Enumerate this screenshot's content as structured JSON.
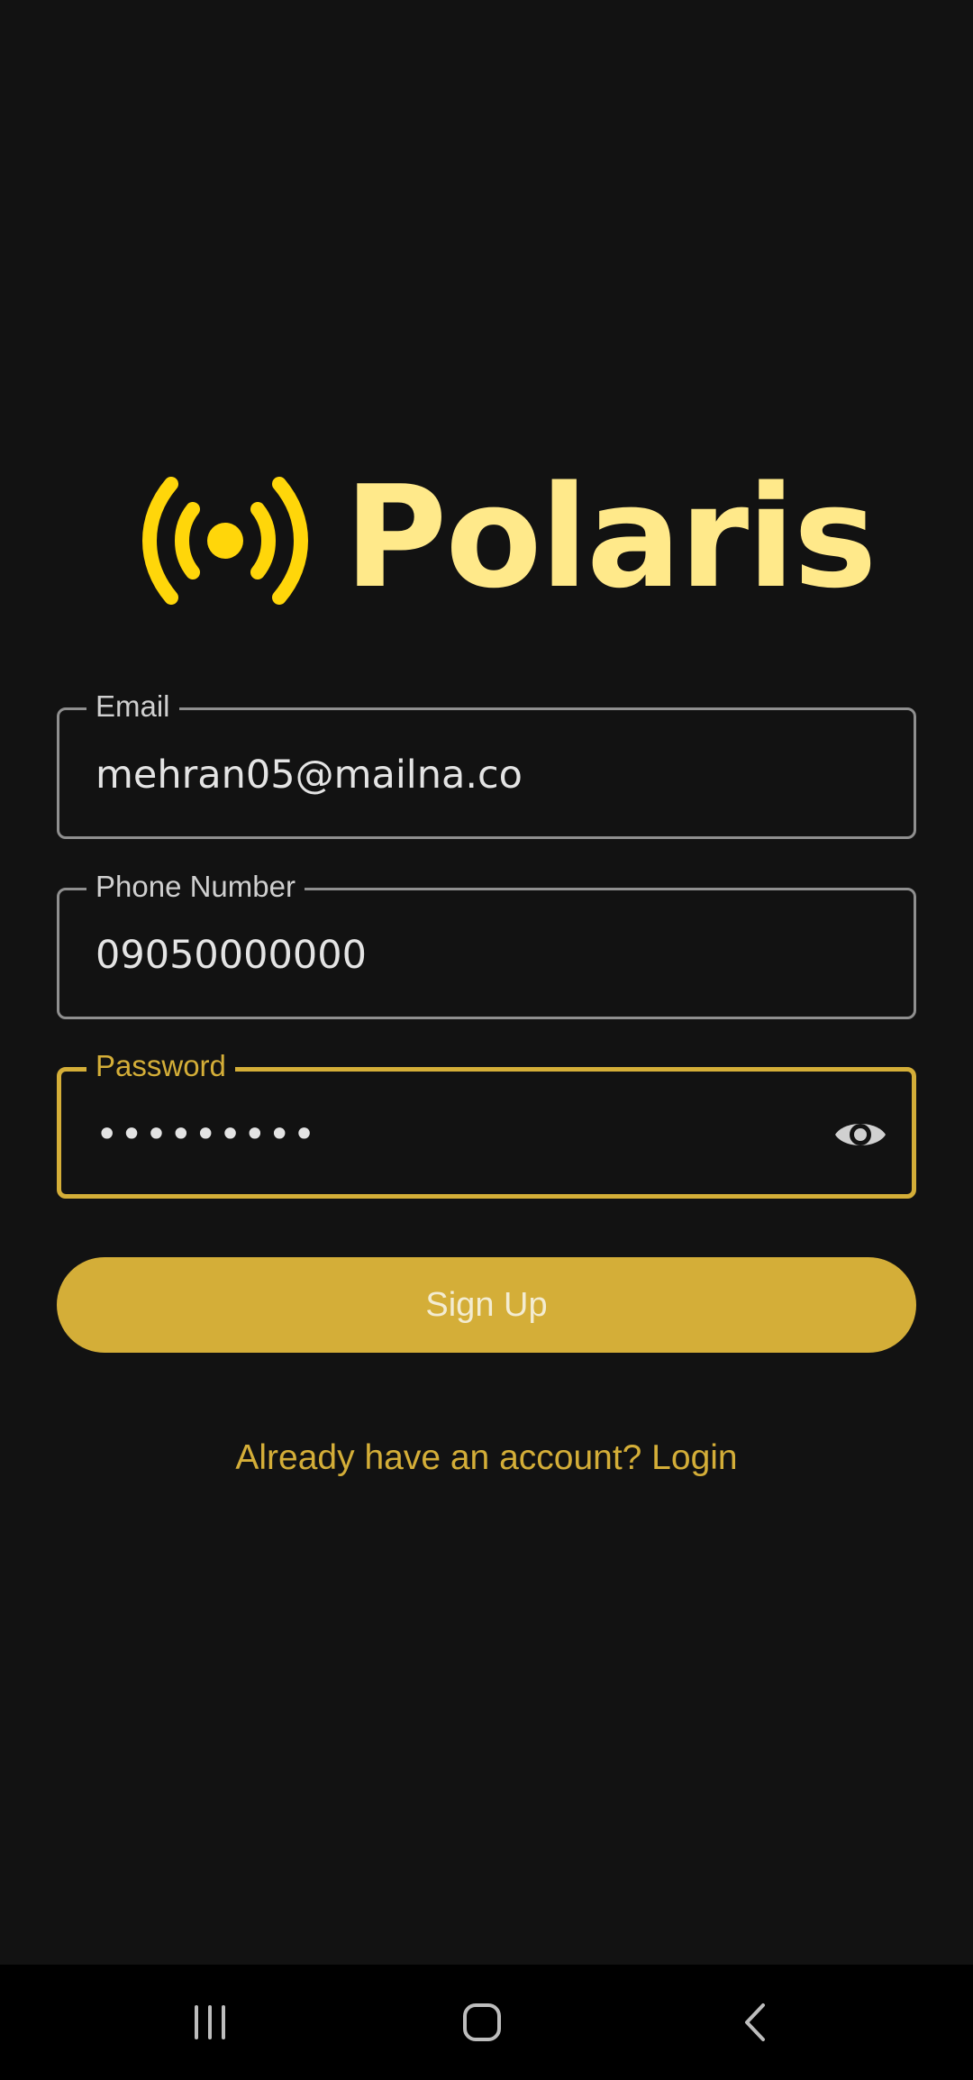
{
  "app": {
    "brand_name": "Polaris"
  },
  "colors": {
    "background": "#121212",
    "accent": "#d4ae38",
    "logo_icon": "#ffd60a",
    "logo_text": "#ffe98a",
    "field_border": "#8f8f8f"
  },
  "form": {
    "email": {
      "label": "Email",
      "value": "mehran05@mailna.co"
    },
    "phone": {
      "label": "Phone Number",
      "value": "09050000000"
    },
    "password": {
      "label": "Password",
      "value": "•••••••••",
      "toggle_icon": "eye-icon"
    },
    "submit_label": "Sign Up",
    "login_link": "Already have an account? Login"
  },
  "navbar": {
    "icons": [
      "recent-apps-icon",
      "home-icon",
      "back-icon"
    ]
  }
}
